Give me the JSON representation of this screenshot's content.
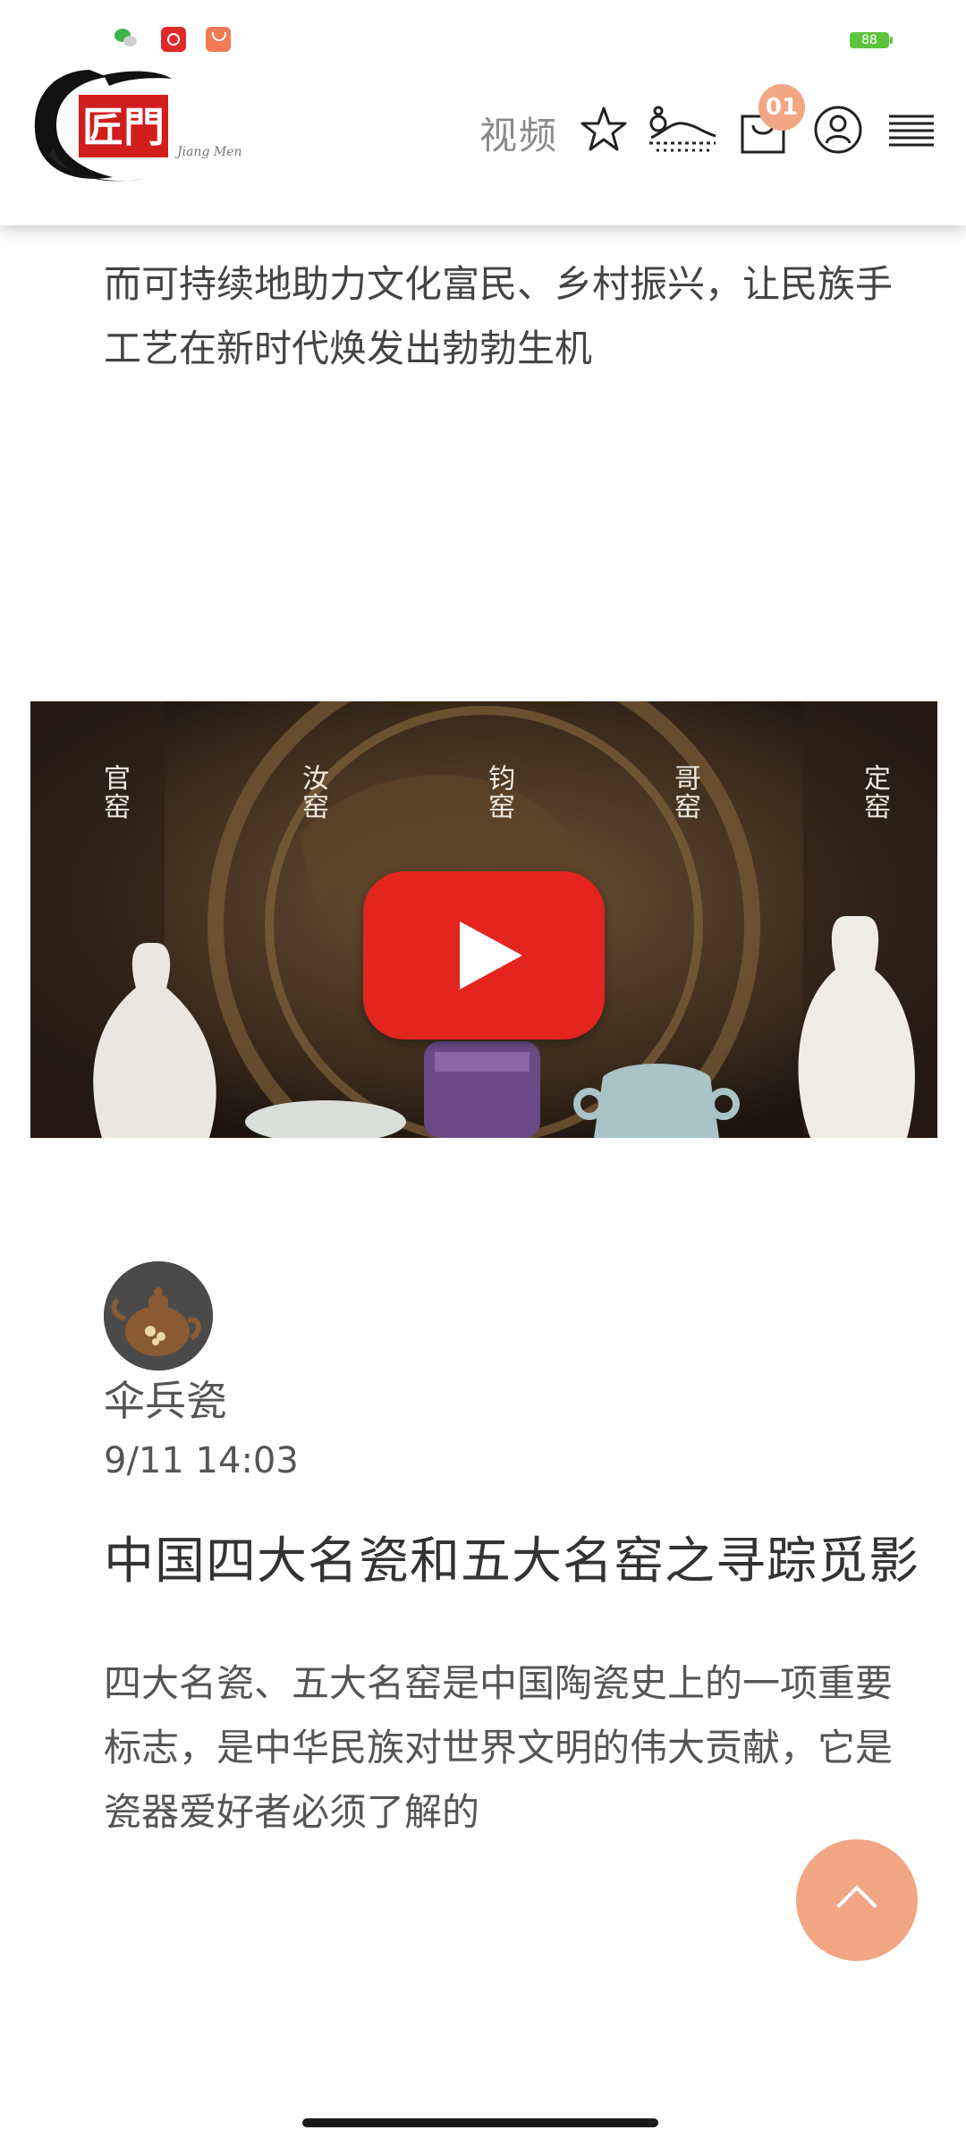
{
  "status_bar": {
    "app_icons": [
      "wechat-icon",
      "netease-music-icon",
      "shopping-bag-icon"
    ],
    "battery": "88",
    "battery_color": "#5cc43c"
  },
  "header": {
    "logo_text": "匠門",
    "logo_subtext": "Jiang Men",
    "nav_video": "视频",
    "cart_count": "01",
    "accent_color": "#f3a684"
  },
  "previous_article": {
    "lines": [
      "而可持续地助力文化富民、乡村振兴，让民族手",
      "工艺在新时代焕发出勃勃生机"
    ]
  },
  "video": {
    "kiln_labels": [
      "官窑",
      "汝窑",
      "钧窑",
      "哥窑",
      "定窑"
    ],
    "play_color": "#e3241f"
  },
  "post": {
    "author": "伞兵瓷",
    "time": "9/11 14:03",
    "title": "中国四大名瓷和五大名窑之寻踪觅影",
    "excerpt_lines": [
      "四大名瓷、五大名窑是中国陶瓷史上的一项重要",
      "标志，是中华民族对世界文明的伟大贡献，它是",
      "瓷器爱好者必须了解的"
    ]
  }
}
